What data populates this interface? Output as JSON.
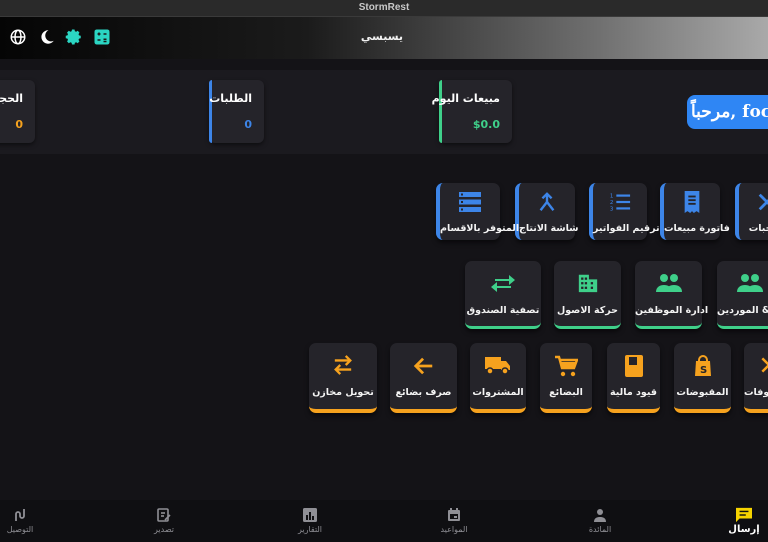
{
  "window": {
    "title": "StormRest"
  },
  "appbar": {
    "title": "يسبسي"
  },
  "welcome": {
    "text": "مرحباً, foch"
  },
  "stats": [
    {
      "label": "مبيعات اليوم",
      "value": "$0.0",
      "color": "#3fd08a"
    },
    {
      "label": "الطلبات",
      "value": "0",
      "color": "#3d85e8"
    },
    {
      "label": "الحجوزات",
      "value": "0",
      "color": "#f6a21e"
    }
  ],
  "row1": [
    {
      "label": "الوجبات",
      "icon": "close-icon"
    },
    {
      "label": "فاتورة مبيعات",
      "icon": "receipt-icon"
    },
    {
      "label": "ترقيم الفواتير",
      "icon": "numbered-list-icon"
    },
    {
      "label": "شاشة الانتاج",
      "icon": "merge-icon"
    },
    {
      "label": "المتوفر بالاقسام",
      "icon": "storage-icon"
    }
  ],
  "row2": [
    {
      "label": "العملاء & الموردين",
      "icon": "people-icon"
    },
    {
      "label": "ادارة الموظفين",
      "icon": "group-icon"
    },
    {
      "label": "حركة الاصول",
      "icon": "building-icon"
    },
    {
      "label": "تصفية الصندوق",
      "icon": "compare-arrows-icon"
    }
  ],
  "row3": [
    {
      "label": "المصروفات",
      "icon": "close-icon"
    },
    {
      "label": "المقبوضات",
      "icon": "shopping-bag-icon"
    },
    {
      "label": "قيود مالية",
      "icon": "book-icon"
    },
    {
      "label": "البضائع",
      "icon": "cart-icon"
    },
    {
      "label": "المشتروات",
      "icon": "truck-icon"
    },
    {
      "label": "صرف بضائع",
      "icon": "arrow-left-icon"
    },
    {
      "label": "تحويل مخازن",
      "icon": "swap-icon"
    }
  ],
  "bottom_nav": [
    {
      "label": "إرسال",
      "icon": "message-icon",
      "active": true
    },
    {
      "label": "المائدة",
      "icon": "person-icon"
    },
    {
      "label": "المواعيد",
      "icon": "calendar-icon"
    },
    {
      "label": "التقارير",
      "icon": "chart-icon"
    },
    {
      "label": "تصدير",
      "icon": "export-icon"
    },
    {
      "label": "التوصيل",
      "icon": "route-icon"
    }
  ],
  "colors": {
    "accent_blue": "#3d85e8",
    "accent_green": "#3fd08a",
    "accent_orange": "#f6a21e",
    "active_nav": "#f5d300"
  }
}
